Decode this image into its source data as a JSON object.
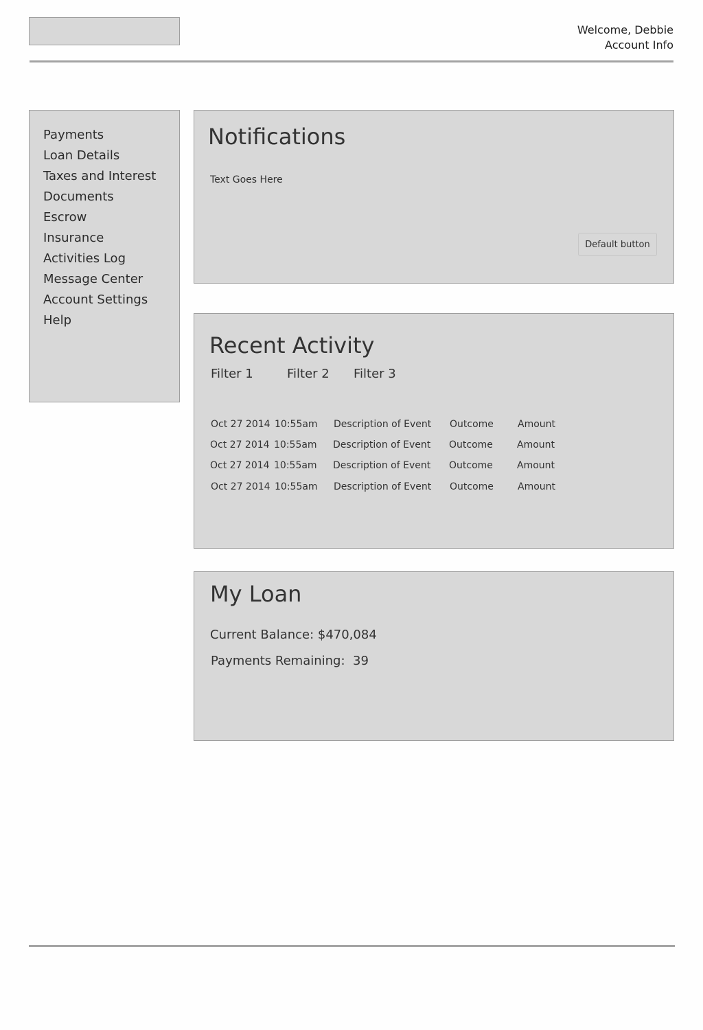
{
  "header": {
    "welcome": "Welcome, Debbie",
    "account_link": "Account Info"
  },
  "sidebar": {
    "items": [
      {
        "label": "Payments"
      },
      {
        "label": "Loan Details"
      },
      {
        "label": "Taxes and Interest"
      },
      {
        "label": "Documents"
      },
      {
        "label": "Escrow"
      },
      {
        "label": "Insurance"
      },
      {
        "label": "Activities Log"
      },
      {
        "label": "Message Center"
      },
      {
        "label": "Account Settings"
      },
      {
        "label": "Help"
      }
    ]
  },
  "notifications": {
    "title": "Notifications",
    "text": "Text Goes Here",
    "button_label": "Default button"
  },
  "activity": {
    "title": "Recent Activity",
    "filters": [
      "Filter 1",
      "Filter 2",
      "Filter 3"
    ],
    "rows": [
      {
        "date": "Oct 27 2014",
        "time": "10:55am",
        "description": "Description of Event",
        "outcome": "Outcome",
        "amount": "Amount"
      },
      {
        "date": "Oct 27 2014",
        "time": "10:55am",
        "description": "Description of Event",
        "outcome": "Outcome",
        "amount": "Amount"
      },
      {
        "date": "Oct 27 2014",
        "time": "10:55am",
        "description": "Description of Event",
        "outcome": "Outcome",
        "amount": "Amount"
      },
      {
        "date": "Oct 27 2014",
        "time": "10:55am",
        "description": "Description of Event",
        "outcome": "Outcome",
        "amount": "Amount"
      }
    ]
  },
  "loan": {
    "title": "My Loan",
    "balance_text": "Current Balance: $470,084",
    "remaining_text": "Payments Remaining:  39"
  },
  "colors": {
    "panel_bg": "#d8d8d8",
    "panel_border": "#9e9e9e",
    "text": "#333333",
    "rule": "#a3a3a3"
  }
}
